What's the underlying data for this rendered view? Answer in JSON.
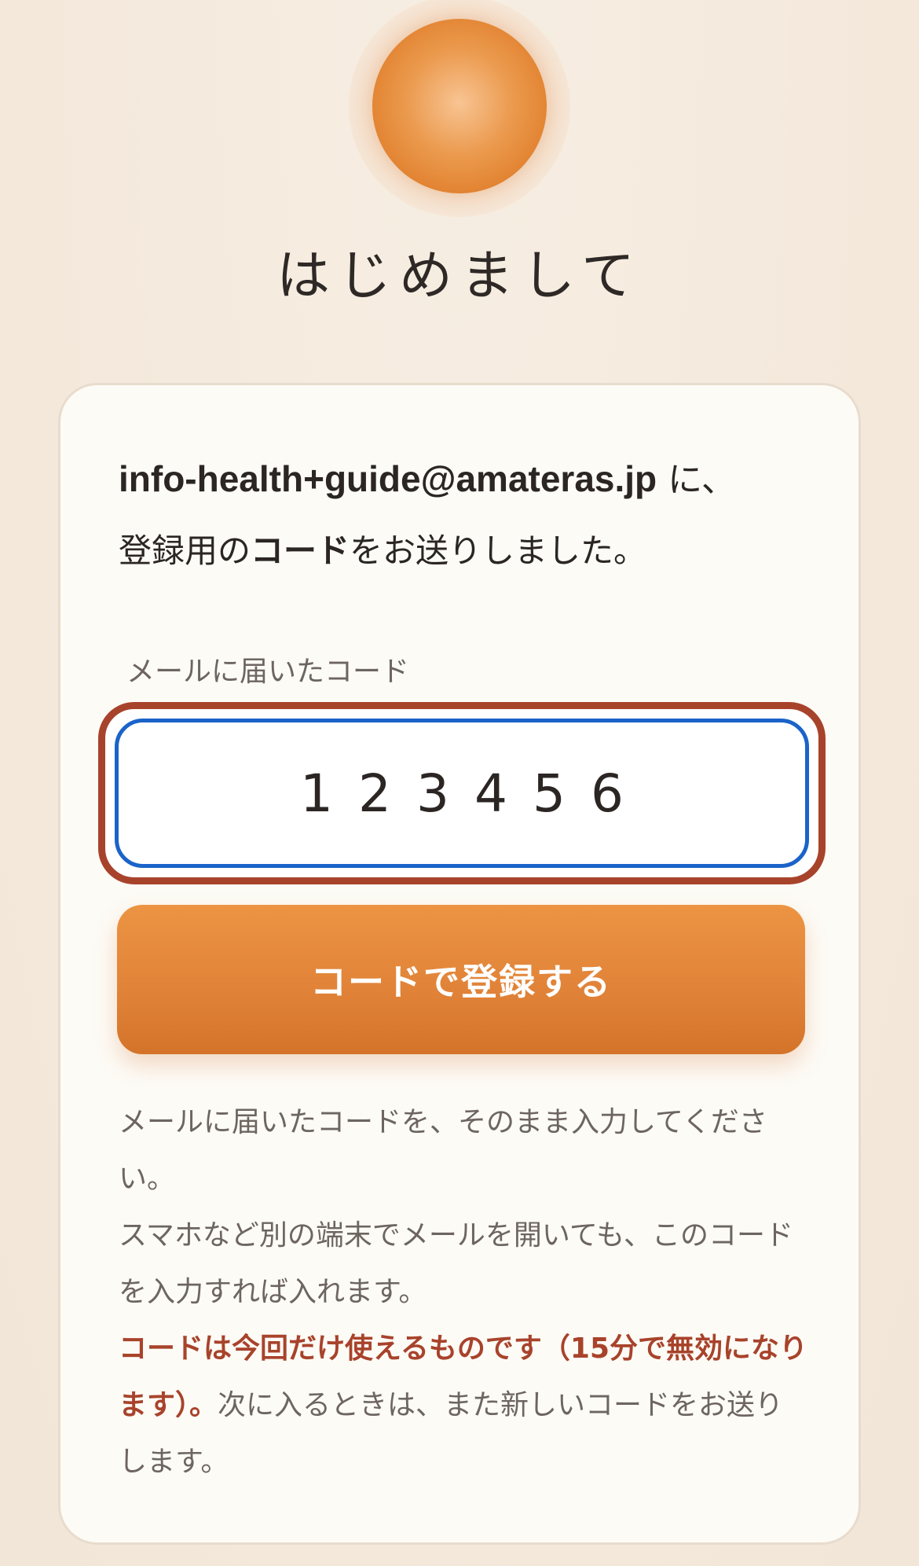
{
  "header": {
    "title": "はじめまして"
  },
  "card": {
    "intro": {
      "email": "info-health+guide@amateras.jp",
      "email_suffix": " に、",
      "line2_prefix": "登録用の",
      "line2_strong": "コード",
      "line2_suffix": "をお送りしました。"
    },
    "code_field": {
      "label": "メールに届いたコード",
      "value": "123456"
    },
    "submit_label": "コードで登録する",
    "help": {
      "p1": "メールに届いたコードを、そのまま入力してください。",
      "p2": "スマホなど別の端末でメールを開いても、このコードを入力すれば入れます。",
      "p3_warning": "コードは今回だけ使えるものです（15分で無効になります）。",
      "p3_rest": "次に入るときは、また新しいコードをお送りします。"
    }
  },
  "colors": {
    "accent": "#e2853a",
    "warning": "#a8432b",
    "focus_ring": "#1a63c9"
  }
}
